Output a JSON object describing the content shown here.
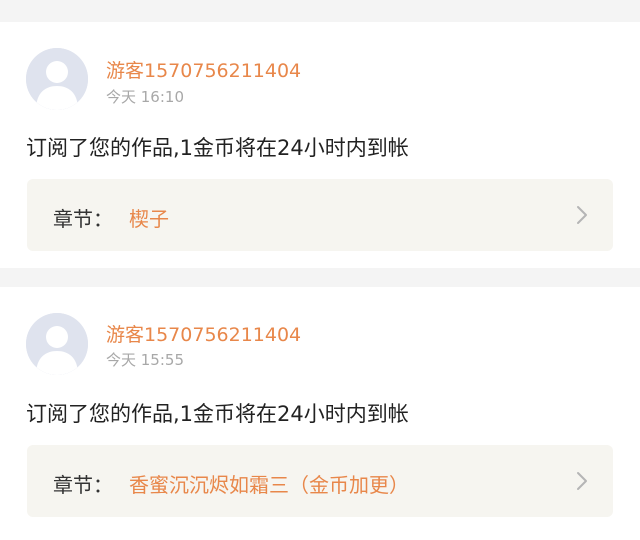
{
  "notifications": [
    {
      "username": "游客1570756211404",
      "time": "今天 16:10",
      "message": "订阅了您的作品,1金币将在24小时内到帐",
      "chapter_label": "章节：",
      "chapter_title": "楔子"
    },
    {
      "username": "游客1570756211404",
      "time": "今天 15:55",
      "message": "订阅了您的作品,1金币将在24小时内到帐",
      "chapter_label": "章节：",
      "chapter_title": "香蜜沉沉烬如霜三（金币加更）"
    }
  ],
  "icons": {
    "avatar": "default-avatar-icon",
    "chevron": "chevron-right-icon"
  },
  "colors": {
    "accent": "#e8874a",
    "text": "#222222",
    "muted": "#a8a8a8",
    "chapter_bg": "#f6f5f0",
    "page_bg": "#f4f4f4"
  }
}
